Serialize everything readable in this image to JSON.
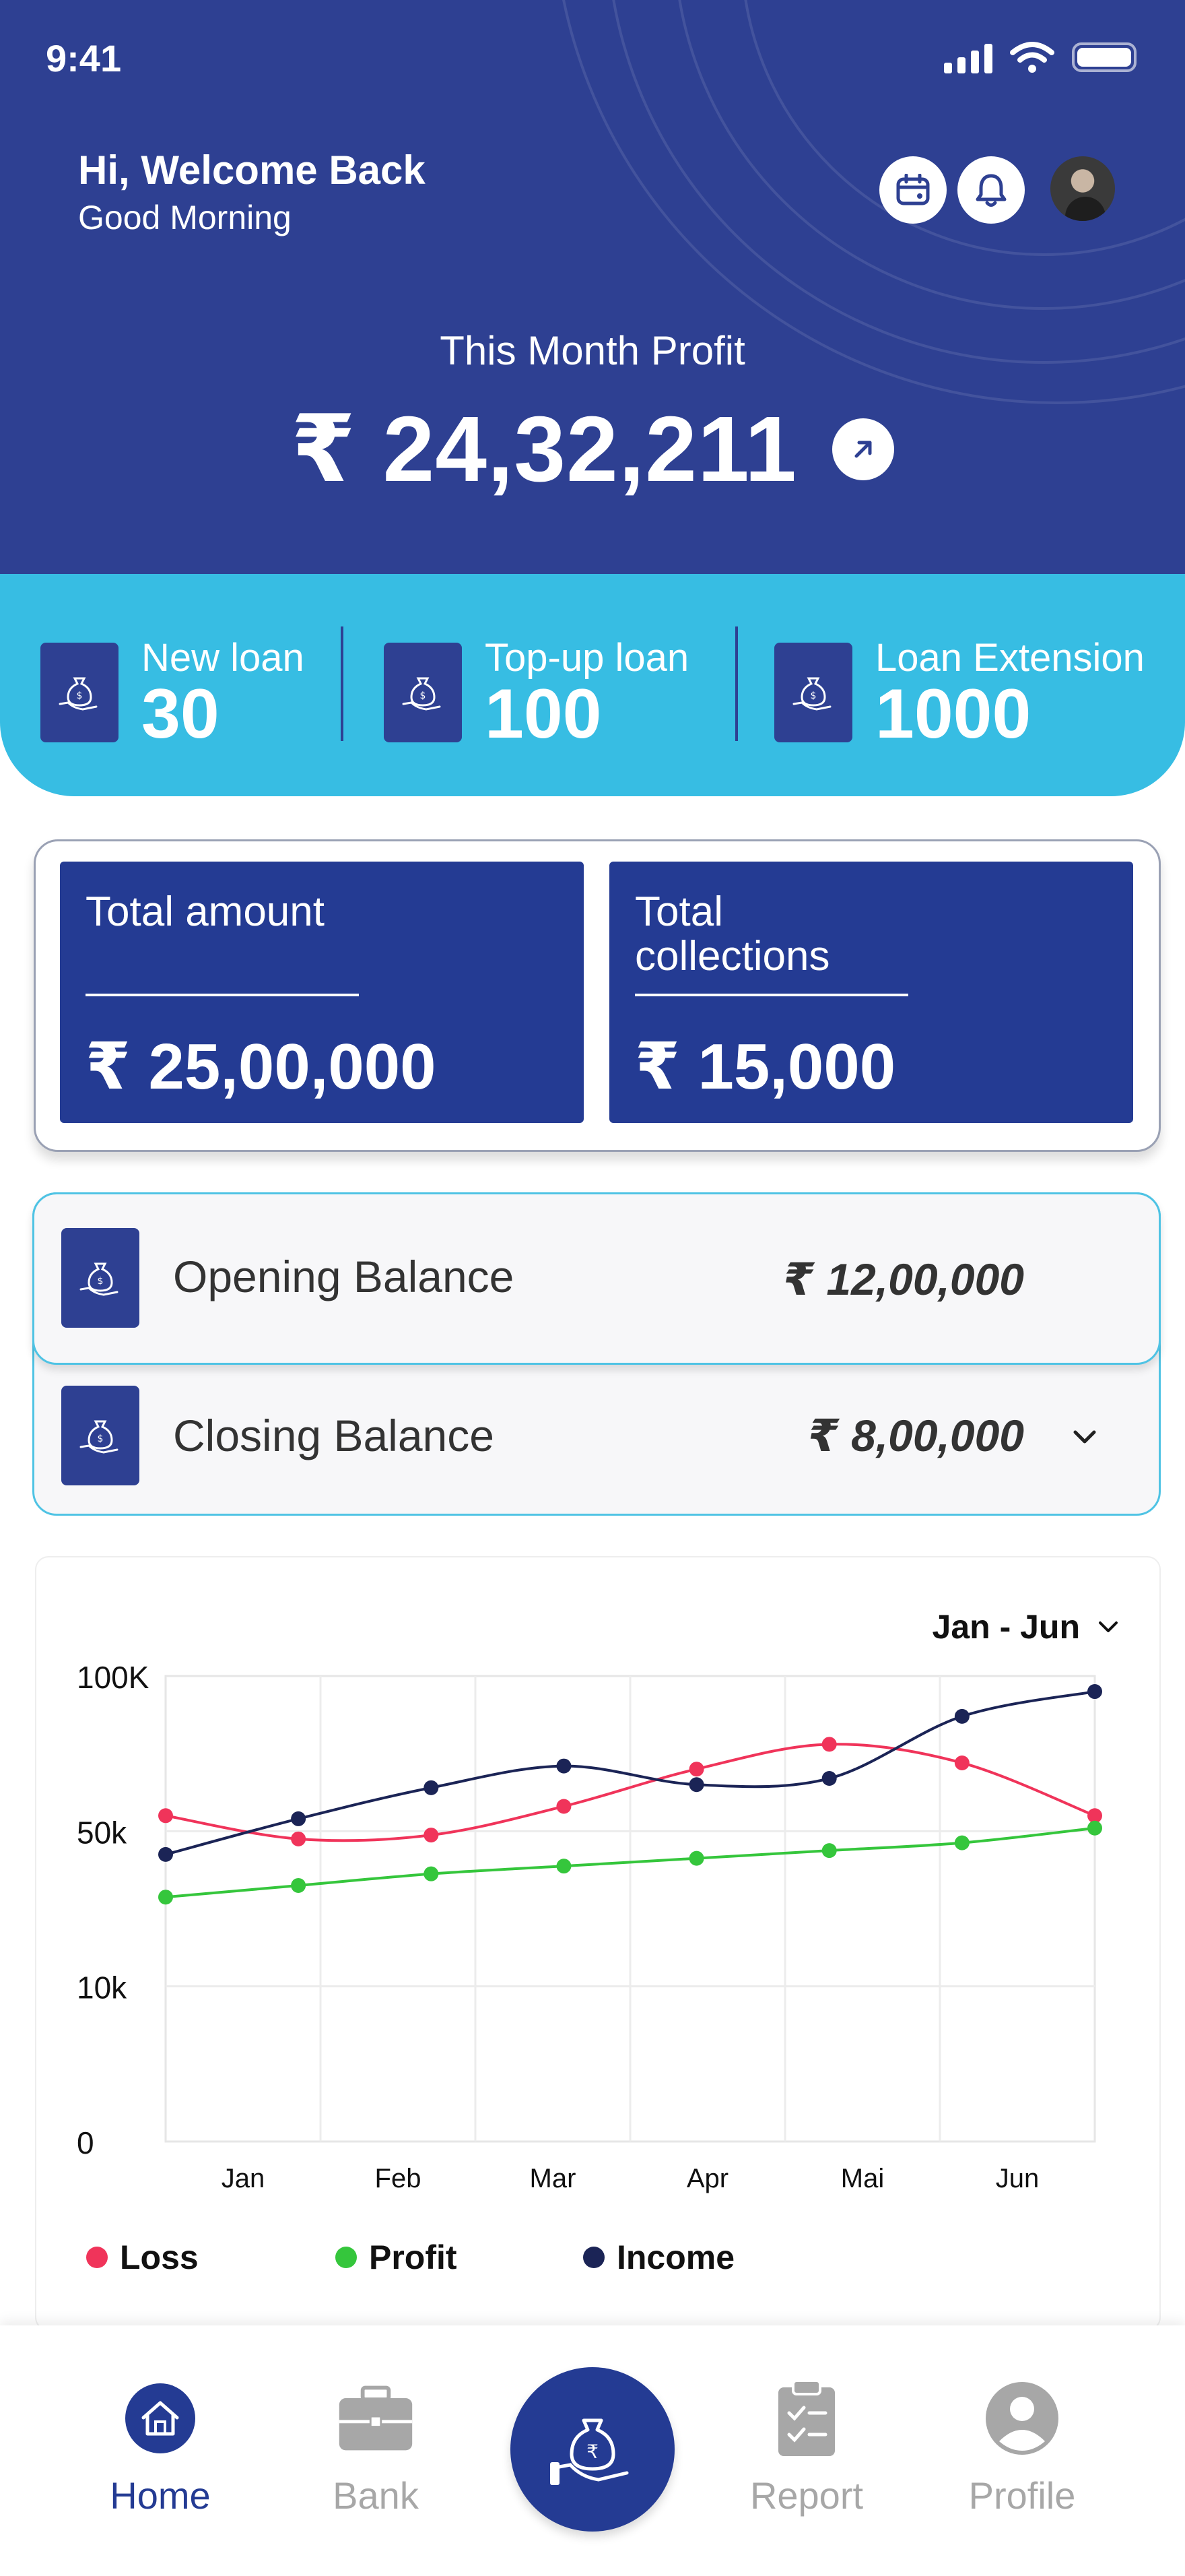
{
  "status_bar": {
    "time": "9:41"
  },
  "header": {
    "greeting": "Hi, Welcome Back",
    "subgreeting": "Good Morning",
    "profit_label": "This Month Profit",
    "profit_value": "₹ 24,32,211",
    "icons": [
      "calendar-icon",
      "bell-icon",
      "avatar"
    ]
  },
  "loans": [
    {
      "label": "New loan",
      "value": "30"
    },
    {
      "label": "Top-up loan",
      "value": "100"
    },
    {
      "label": "Loan Extension",
      "value": "1000"
    }
  ],
  "summary": {
    "total_amount": {
      "label": "Total amount",
      "value": "₹  25,00,000"
    },
    "total_collections": {
      "label": "Total collections",
      "value": "₹  15,000"
    }
  },
  "balances": {
    "opening": {
      "label": "Opening Balance",
      "value": "₹ 12,00,000"
    },
    "closing": {
      "label": "Closing Balance",
      "value": "₹ 8,00,000"
    }
  },
  "chart": {
    "range": "Jan - Jun",
    "legend": [
      "Loss",
      "Profit",
      "Income"
    ]
  },
  "colors": {
    "header_bg": "#2e4092",
    "strip_bg": "#37bde3",
    "card_blue": "#243b93",
    "loss": "#f0345a",
    "profit": "#35c63c",
    "income": "#1b2456"
  },
  "chart_data": {
    "type": "line",
    "categories": [
      "Jan",
      "Feb",
      "Mar",
      "Apr",
      "Mai",
      "Jun"
    ],
    "y_tick_labels": [
      "0",
      "10k",
      "50k",
      "100K"
    ],
    "ylim": [
      0,
      100000
    ],
    "grid": true,
    "legend_position": "bottom",
    "series": [
      {
        "name": "Loss",
        "color": "#f0345a",
        "values": [
          55000,
          48000,
          49000,
          58000,
          70000,
          78000,
          72000,
          55000
        ]
      },
      {
        "name": "Profit",
        "color": "#35c63c",
        "values": [
          33000,
          36000,
          39000,
          41000,
          43000,
          45000,
          47000,
          51000
        ]
      },
      {
        "name": "Income",
        "color": "#1b2456",
        "values": [
          44000,
          54000,
          64000,
          71000,
          65000,
          67000,
          87000,
          95000
        ]
      }
    ],
    "x_positions": [
      0,
      0.5,
      1,
      1.5,
      2,
      2.5,
      3,
      3.5
    ],
    "note": ""
  },
  "nav": {
    "items": [
      {
        "label": "Home",
        "icon": "home-icon",
        "active": true
      },
      {
        "label": "Bank",
        "icon": "briefcase-icon",
        "active": false
      },
      {
        "label": "",
        "icon": "money-bag-hand-icon",
        "active": false
      },
      {
        "label": "Report",
        "icon": "clipboard-icon",
        "active": false
      },
      {
        "label": "Profile",
        "icon": "user-icon",
        "active": false
      }
    ]
  }
}
